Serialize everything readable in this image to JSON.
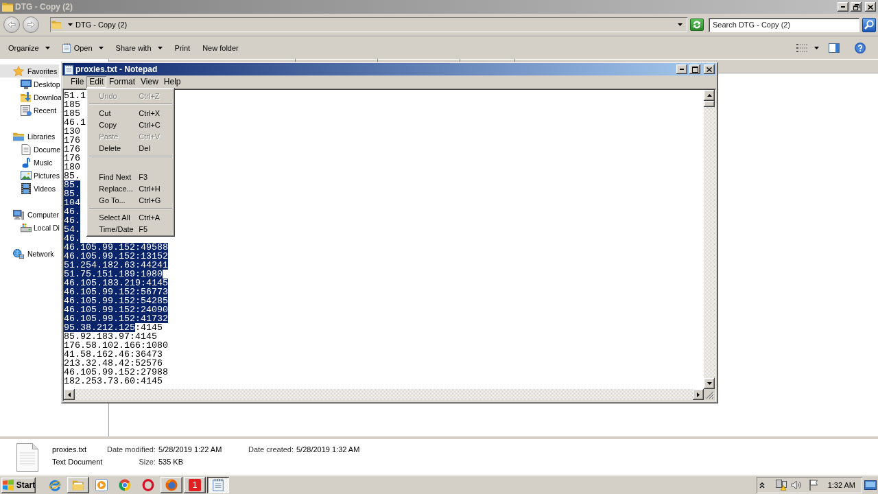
{
  "explorer": {
    "title": "DTG - Copy (2)",
    "address": {
      "path": "DTG - Copy (2)"
    },
    "search": {
      "placeholder": "Search DTG - Copy (2)"
    },
    "toolbar": [
      {
        "label": "Organize",
        "dropdown": true
      },
      {
        "label": "Open",
        "dropdown": true
      },
      {
        "label": "Share with",
        "dropdown": true
      },
      {
        "label": "Print",
        "dropdown": false
      },
      {
        "label": "New folder",
        "dropdown": false
      }
    ],
    "navigation": [
      {
        "label": "Favorites",
        "selected": true,
        "children": [
          {
            "label": "Desktop",
            "selected": false
          },
          {
            "label": "Downloa",
            "selected": false
          },
          {
            "label": "Recent",
            "selected": false
          }
        ]
      },
      {
        "label": "Libraries",
        "selected": false,
        "children": [
          {
            "label": "Docume",
            "selected": false
          },
          {
            "label": "Music",
            "selected": false
          },
          {
            "label": "Pictures",
            "selected": false
          },
          {
            "label": "Videos",
            "selected": false
          }
        ]
      },
      {
        "label": "Computer",
        "selected": false,
        "children": [
          {
            "label": "Local Di",
            "selected": false
          }
        ]
      },
      {
        "label": "Network",
        "selected": false
      }
    ],
    "details": {
      "name": "proxies.txt",
      "type": "Text Document",
      "fields": [
        {
          "label": "Date modified:",
          "value": "5/28/2019 1:22 AM"
        },
        {
          "label": "Size:",
          "value": "535 KB"
        },
        {
          "label": "Date created:",
          "value": "5/28/2019 1:32 AM"
        }
      ]
    }
  },
  "notepad": {
    "title": "proxies.txt - Notepad",
    "menu": [
      {
        "label": "File",
        "selected": false
      },
      {
        "label": "Edit",
        "selected": true
      },
      {
        "label": "Format",
        "selected": false
      },
      {
        "label": "View",
        "selected": false
      },
      {
        "label": "Help",
        "selected": false
      }
    ],
    "lines": [
      {
        "text": "51.1",
        "selected": false
      },
      {
        "text": "185",
        "selected": false
      },
      {
        "text": "185",
        "selected": false
      },
      {
        "text": "46.1",
        "selected": false
      },
      {
        "text": "130",
        "selected": false
      },
      {
        "text": "176",
        "selected": false
      },
      {
        "text": "176",
        "selected": false
      },
      {
        "text": "176",
        "selected": false
      },
      {
        "text": "180",
        "selected": false
      },
      {
        "text": "85.",
        "selected": false
      },
      {
        "text": "85.",
        "selected": true
      },
      {
        "text": "85.",
        "selected": true
      },
      {
        "text": "104",
        "selected": true
      },
      {
        "text": "46.",
        "selected": true
      },
      {
        "text": "46.",
        "selected": true
      },
      {
        "text": "54.",
        "selected": true
      },
      {
        "text": "46.",
        "selected": true
      },
      {
        "text": "46.105.99.152:49588",
        "selected": true
      },
      {
        "text": "46.105.99.152:13152",
        "selected": true
      },
      {
        "text": "51.254.182.63:44241",
        "selected": true
      },
      {
        "text": "51.75.151.189:1080",
        "selected": true
      },
      {
        "text": "46.105.183.219:4145",
        "selected": true
      },
      {
        "text": "46.105.99.152:56773",
        "selected": true
      },
      {
        "text": "46.105.99.152:54285",
        "selected": true
      },
      {
        "text": "46.105.99.152:24090",
        "selected": true
      },
      {
        "text": "46.105.99.152:41732",
        "selected": true
      },
      {
        "text": "95.38.212.125",
        "selected": true,
        "rest": {
          "text": ":4145",
          "selected": false
        }
      },
      {
        "text": "85.92.183.97:4145",
        "selected": false
      },
      {
        "text": "176.58.102.166:1080",
        "selected": false
      },
      {
        "text": "41.58.162.46:36473",
        "selected": false
      },
      {
        "text": "213.32.48.42:52576",
        "selected": false
      },
      {
        "text": "46.105.99.152:27988",
        "selected": false
      },
      {
        "text": "182.253.73.60:4145",
        "selected": false
      }
    ],
    "edit_menu": [
      {
        "kind": "item",
        "label": "Undo",
        "shortcut": "Ctrl+Z",
        "disabled": true
      },
      {
        "kind": "separator"
      },
      {
        "kind": "item",
        "label": "Cut",
        "shortcut": "Ctrl+X",
        "disabled": false
      },
      {
        "kind": "item",
        "label": "Copy",
        "shortcut": "Ctrl+C",
        "disabled": false
      },
      {
        "kind": "item",
        "label": "Paste",
        "shortcut": "Ctrl+V",
        "disabled": true
      },
      {
        "kind": "item",
        "label": "Delete",
        "shortcut": "Del",
        "disabled": false
      },
      {
        "kind": "separator"
      },
      {
        "kind": "blank"
      },
      {
        "kind": "item",
        "label": "Find Next",
        "shortcut": "F3",
        "disabled": false
      },
      {
        "kind": "item",
        "label": "Replace...",
        "shortcut": "Ctrl+H",
        "disabled": false
      },
      {
        "kind": "item",
        "label": "Go To...",
        "shortcut": "Ctrl+G",
        "disabled": false
      },
      {
        "kind": "separator"
      },
      {
        "kind": "item",
        "label": "Select All",
        "shortcut": "Ctrl+A",
        "disabled": false
      },
      {
        "kind": "item",
        "label": "Time/Date",
        "shortcut": "F5",
        "disabled": false
      }
    ]
  },
  "taskbar": {
    "start": "Start",
    "apps": [
      {
        "running": false,
        "selected": false
      },
      {
        "running": true,
        "selected": false
      },
      {
        "running": false,
        "selected": false
      },
      {
        "running": false,
        "selected": false
      },
      {
        "running": false,
        "selected": false
      },
      {
        "running": true,
        "selected": false
      },
      {
        "running": true,
        "selected": false,
        "label": "1"
      },
      {
        "running": true,
        "selected": true
      }
    ],
    "clock": "1:32 AM"
  }
}
